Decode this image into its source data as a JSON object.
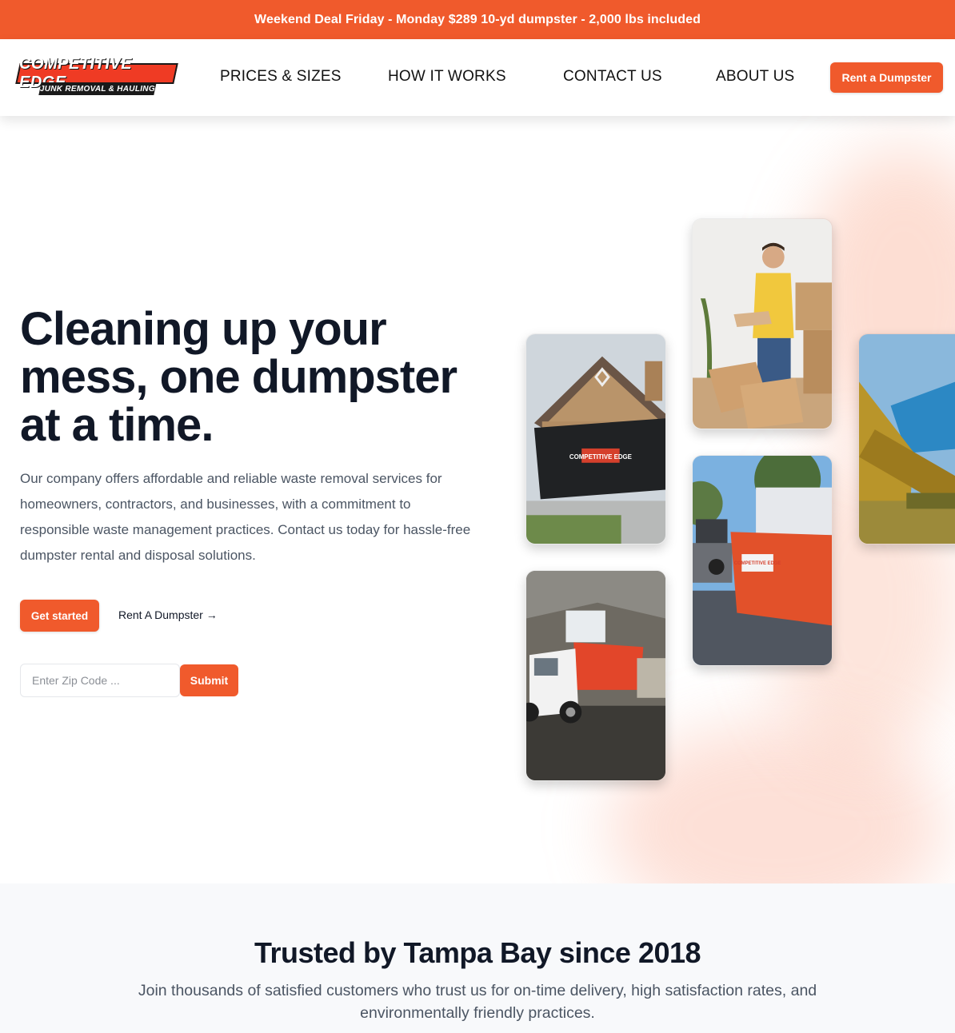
{
  "banner": {
    "text": "Weekend Deal Friday - Monday $289 10-yd dumpster - 2,000 lbs included"
  },
  "header": {
    "logo": {
      "line1": "COMPETITIVE EDGE",
      "line2": "JUNK REMOVAL & HAULING"
    },
    "nav": [
      {
        "label": "PRICES & SIZES"
      },
      {
        "label": "HOW IT WORKS"
      },
      {
        "label": "CONTACT US"
      },
      {
        "label": "ABOUT US"
      }
    ],
    "cta_label": "Rent a Dumpster"
  },
  "hero": {
    "headline": "Cleaning up your mess, one dumpster at a time.",
    "description": "Our company offers affordable and reliable waste removal services for homeowners, contractors, and businesses, with a commitment to responsible waste management practices. Contact us today for hassle-free dumpster rental and disposal solutions.",
    "primary_button": "Get started",
    "secondary_link": "Rent A Dumpster →",
    "zip": {
      "placeholder": "Enter Zip Code ...",
      "value": "",
      "submit_label": "Submit"
    },
    "photos": [
      {
        "name": "man-moving-boxes-photo",
        "sign_text": ""
      },
      {
        "name": "black-dumpster-driveway-photo",
        "sign_text": "COMPETITIVE EDGE"
      },
      {
        "name": "dumpster-lift-photo",
        "sign_text": ""
      },
      {
        "name": "red-roll-off-dumpster-photo",
        "sign_text": "COMPETITIVE EDGE"
      },
      {
        "name": "dump-truck-warehouse-photo",
        "sign_text": ""
      }
    ]
  },
  "trusted": {
    "title": "Trusted by Tampa Bay since 2018",
    "subtitle": "Join thousands of satisfied customers who trust us for on-time delivery, high satisfaction rates, and environmentally friendly practices."
  },
  "colors": {
    "accent": "#f05a2c",
    "heading": "#111827",
    "body_text": "#4b5563",
    "section_bg": "#f8f9fb"
  }
}
